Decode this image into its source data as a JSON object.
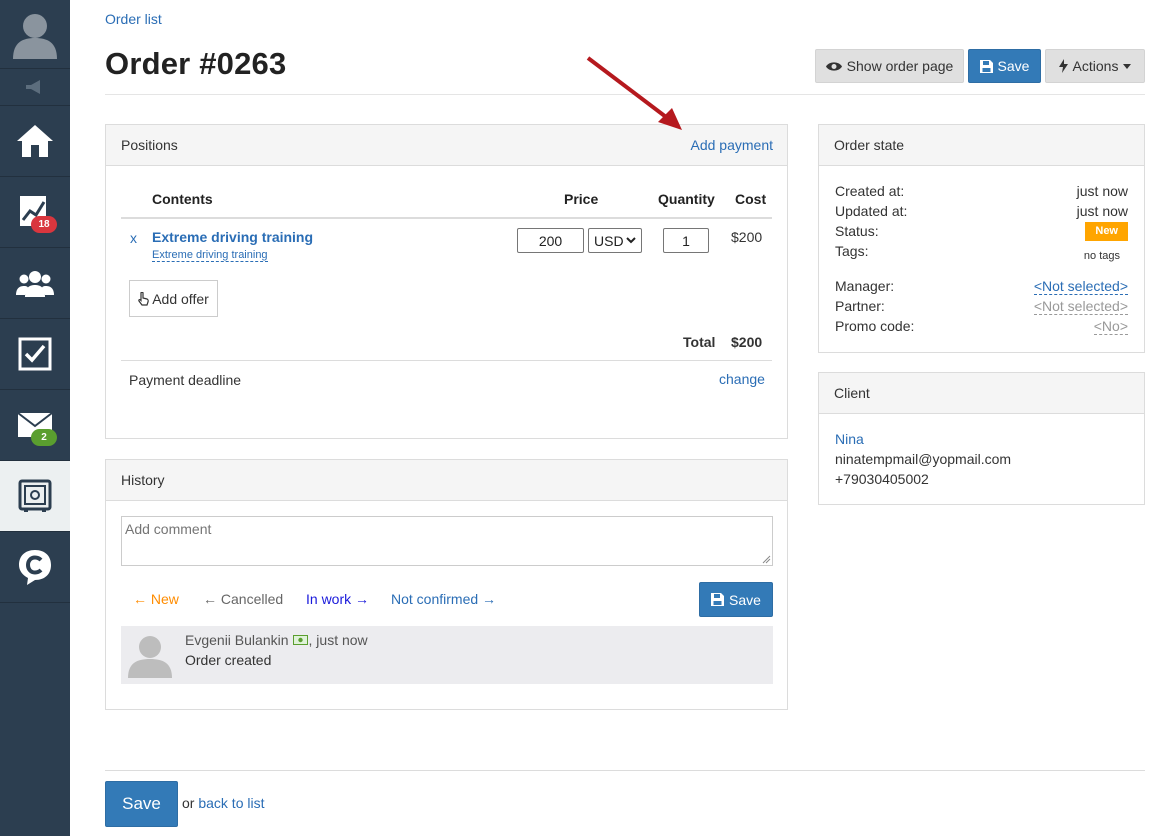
{
  "breadcrumb": "Order list",
  "page_title": "Order #0263",
  "header_buttons": {
    "show_order_page": "Show order page",
    "save": "Save",
    "actions": "Actions"
  },
  "sidebar": {
    "badges": {
      "analytics": "18",
      "mail": "2"
    }
  },
  "positions": {
    "title": "Positions",
    "add_payment": "Add payment",
    "columns": {
      "contents": "Contents",
      "price": "Price",
      "quantity": "Quantity",
      "cost": "Cost"
    },
    "item": {
      "remove": "x",
      "name": "Extreme driving training",
      "offer": "Extreme driving training",
      "price": "200",
      "currency": "USD",
      "quantity": "1",
      "cost": "$200"
    },
    "add_offer": "Add offer",
    "total_label": "Total",
    "total_value": "$200",
    "payment_deadline": "Payment deadline",
    "change": "change"
  },
  "history": {
    "title": "History",
    "comment_placeholder": "Add comment",
    "statuses": {
      "new": "New",
      "cancelled": "Cancelled",
      "in_work": "In work",
      "not_confirmed": "Not confirmed"
    },
    "save": "Save",
    "entry": {
      "author": "Evgenii Bulankin",
      "time": ", just now",
      "text": "Order created"
    }
  },
  "order_state": {
    "title": "Order state",
    "created_label": "Created at:",
    "created_value": "just now",
    "updated_label": "Updated at:",
    "updated_value": "just now",
    "status_label": "Status:",
    "status_value": "New",
    "tags_label": "Tags:",
    "tags_value": "no tags",
    "manager_label": "Manager:",
    "manager_value": "<Not selected>",
    "partner_label": "Partner:",
    "partner_value": "<Not selected>",
    "promo_label": "Promo code:",
    "promo_value": "<No>"
  },
  "client": {
    "title": "Client",
    "name": "Nina",
    "email": "ninatempmail@yopmail.com",
    "phone": "+79030405002"
  },
  "footer": {
    "save": "Save",
    "or": "or",
    "back": "back to list"
  },
  "colors": {
    "sidebar": "#2c3e50",
    "primary": "#337ab7",
    "link": "#2a6db5",
    "status_new": "#ffa500",
    "badge_red": "#d9363e",
    "badge_green": "#5a9e2f",
    "annotation_arrow": "#b5191e"
  }
}
